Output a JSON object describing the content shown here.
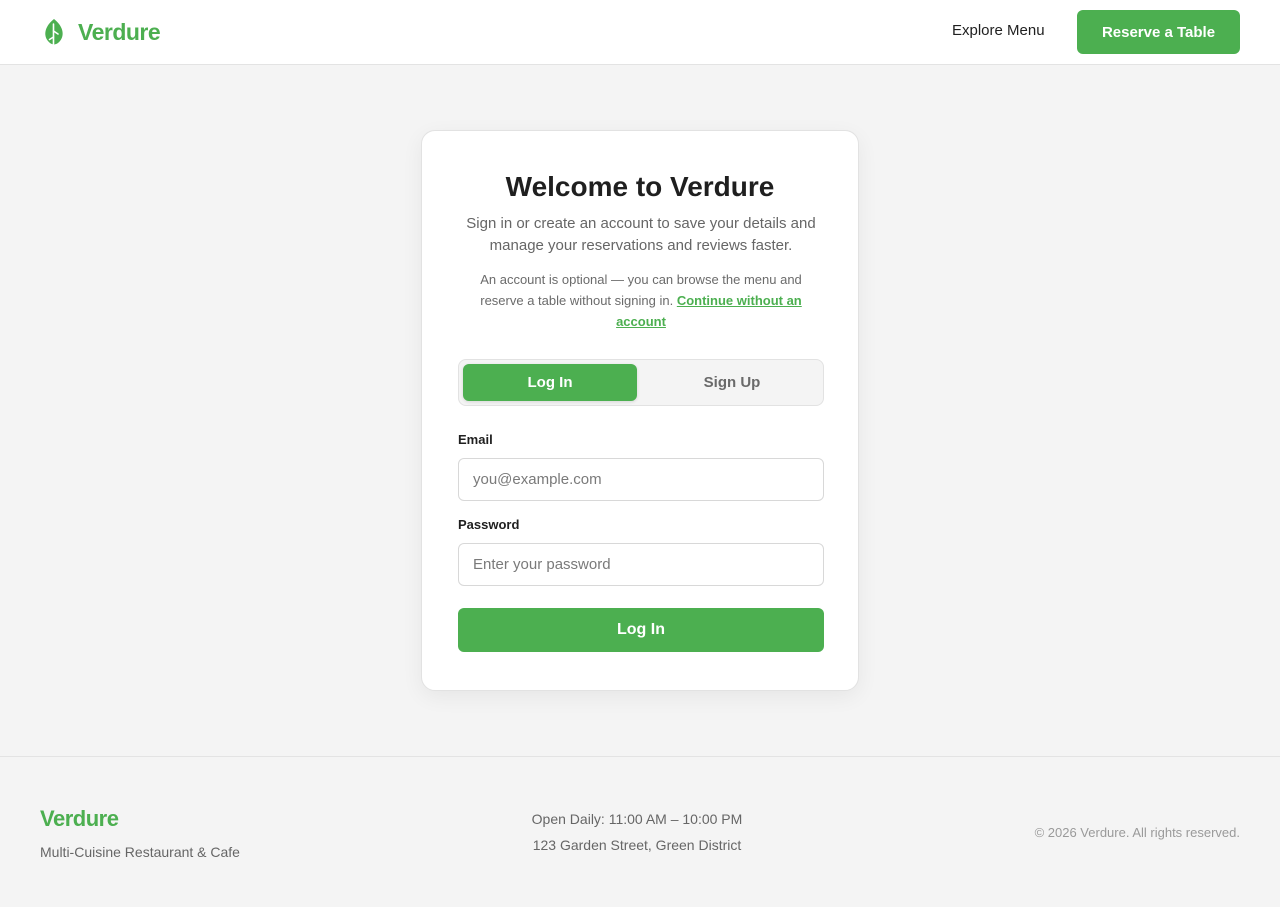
{
  "colors": {
    "brand_green": "#4caf50",
    "page_background": "#f4f4f4",
    "text_primary": "#1f1f1f",
    "text_muted": "#666666"
  },
  "header": {
    "brand_name": "Verdure",
    "brand_icon": "leaf-icon",
    "nav_link": "Explore Menu",
    "cta_label": "Reserve a Table"
  },
  "auth_card": {
    "title": "Welcome to Verdure",
    "subtitle": "Sign in or create an account to save your details and manage your reservations and reviews faster.",
    "note": "An account is optional — you can browse the menu and reserve a table without signing in.",
    "guest_link": "Continue without an account",
    "tabs": [
      {
        "label": "Log In",
        "active": true
      },
      {
        "label": "Sign Up",
        "active": false
      }
    ],
    "email": {
      "label": "Email",
      "placeholder": "you@example.com",
      "value": ""
    },
    "password": {
      "label": "Password",
      "placeholder": "Enter your password",
      "value": ""
    },
    "submit_label": "Log In"
  },
  "footer": {
    "brand_name": "Verdure",
    "tagline": "Multi-Cuisine Restaurant & Cafe",
    "hours": "Open Daily: 11:00 AM – 10:00 PM",
    "address": "123 Garden Street, Green District",
    "copyright": "© 2026 Verdure. All rights reserved."
  }
}
